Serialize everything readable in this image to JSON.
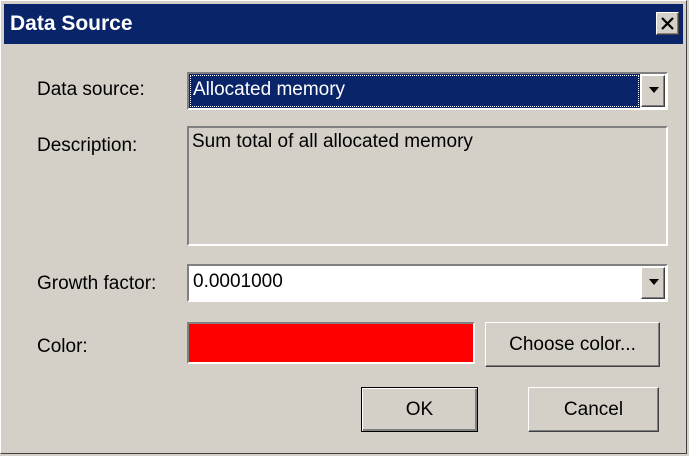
{
  "window": {
    "title": "Data Source",
    "close_icon": "close-icon"
  },
  "data_source": {
    "label": "Data source:",
    "value": "Allocated memory"
  },
  "description": {
    "label": "Description:",
    "text": "Sum total of all allocated memory"
  },
  "growth_factor": {
    "label": "Growth factor:",
    "value": "0.0001000"
  },
  "color": {
    "label": "Color:",
    "swatch": "#ff0000",
    "choose_label": "Choose color..."
  },
  "buttons": {
    "ok": "OK",
    "cancel": "Cancel"
  }
}
